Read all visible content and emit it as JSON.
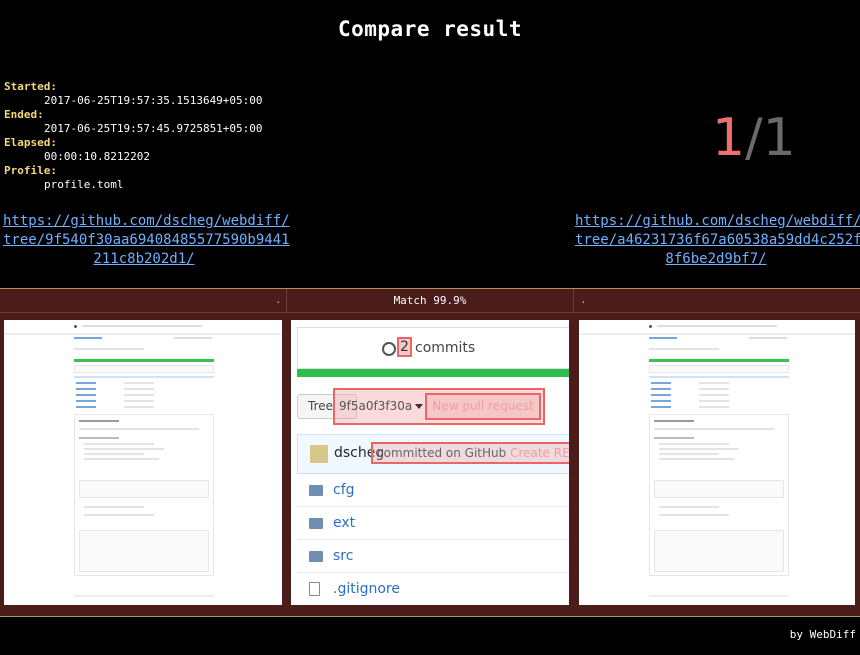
{
  "title": "Compare result",
  "meta": {
    "started_label": "Started:",
    "started": "2017-06-25T19:57:35.1513649+05:00",
    "ended_label": "Ended:",
    "ended": "2017-06-25T19:57:45.9725851+05:00",
    "elapsed_label": "Elapsed:",
    "elapsed": "00:00:10.8212202",
    "profile_label": "Profile:",
    "profile": "profile.toml"
  },
  "counter": {
    "current": "1",
    "separator": "/",
    "total": "1"
  },
  "links": {
    "left": [
      "https://github.com/dscheg/webdiff/",
      "tree/9f540f30aa69408485577590b9441",
      "211c8b202d1/"
    ],
    "right": [
      "https://github.com/dscheg/webdiff/",
      "tree/a46231736f67a60538a59dd4c252f",
      "8f6be2d9bf7/"
    ]
  },
  "compare": {
    "match_text": "Match 99.9%",
    "download_left": ".",
    "download_right": "."
  },
  "diff_view": {
    "commit_count": "2",
    "commits_label": "commits",
    "branch_label": "Tree",
    "branch_overlap": "9f5a0f3f30a",
    "new_pr": "New pull request",
    "author": "dscheg",
    "commit_overlap": "committed on GitHub",
    "commit_tail": "Create REA",
    "files": [
      "cfg",
      "ext",
      "src",
      ".gitignore"
    ]
  },
  "footer": "by WebDiff"
}
